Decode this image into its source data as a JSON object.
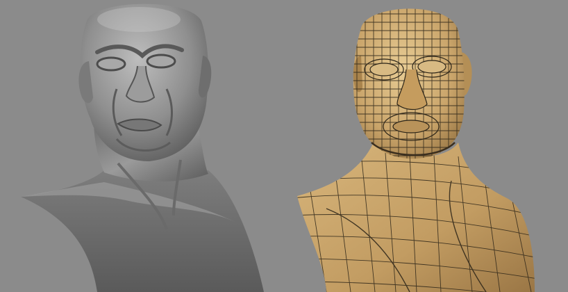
{
  "scene": {
    "background_color": "#8b8b8b",
    "panels": [
      {
        "id": "sculpt",
        "shading": "smooth-grey",
        "base_color": "#8e8e8e",
        "highlight_color": "#c7c7c7",
        "shadow_color": "#4d4d4d"
      },
      {
        "id": "retopo",
        "shading": "wireframe-over-skin",
        "base_color": "#c9a46a",
        "highlight_color": "#e3c48a",
        "shadow_color": "#8a6a3c",
        "wire_color": "#2b2418"
      }
    ]
  }
}
